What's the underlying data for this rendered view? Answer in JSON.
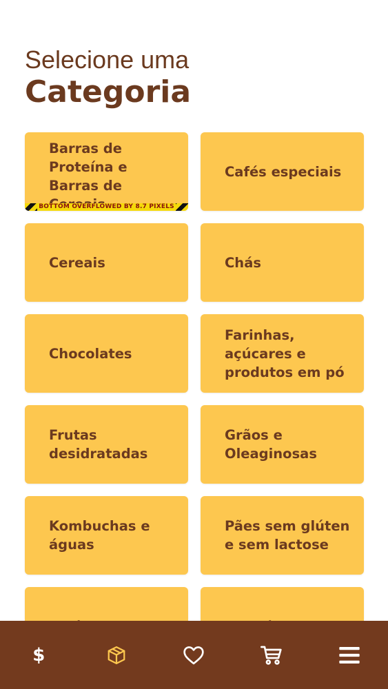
{
  "header": {
    "subtitle": "Selecione uma",
    "title": "Categoria"
  },
  "categories": [
    {
      "label": "Barras de Proteína e Barras de Cereais"
    },
    {
      "label": "Cafés especiais"
    },
    {
      "label": "Cereais"
    },
    {
      "label": "Chás"
    },
    {
      "label": "Chocolates"
    },
    {
      "label": "Farinhas, açúcares e produtos em pó"
    },
    {
      "label": "Frutas desidratadas"
    },
    {
      "label": "Grãos e Oleaginosas"
    },
    {
      "label": "Kombuchas e águas"
    },
    {
      "label": "Pães sem glúten e sem lactose"
    },
    {
      "label": "Patês"
    },
    {
      "label": "Proteínas"
    }
  ],
  "overflow_warning": "BOTTOM OVERFLOWED BY 8.7 PIXELS",
  "navbar": {
    "items": [
      {
        "icon": "dollar-icon",
        "glyph": "$",
        "active": false
      },
      {
        "icon": "package-icon",
        "active": true
      },
      {
        "icon": "heart-icon",
        "active": false
      },
      {
        "icon": "cart-icon",
        "active": false
      },
      {
        "icon": "menu-icon",
        "active": false
      }
    ]
  },
  "colors": {
    "brand_brown": "#733a1e",
    "text_brown": "#6b3a1f",
    "card_yellow": "#fdc74f",
    "active_icon": "#fdc74f",
    "inactive_icon": "#ffffff"
  }
}
